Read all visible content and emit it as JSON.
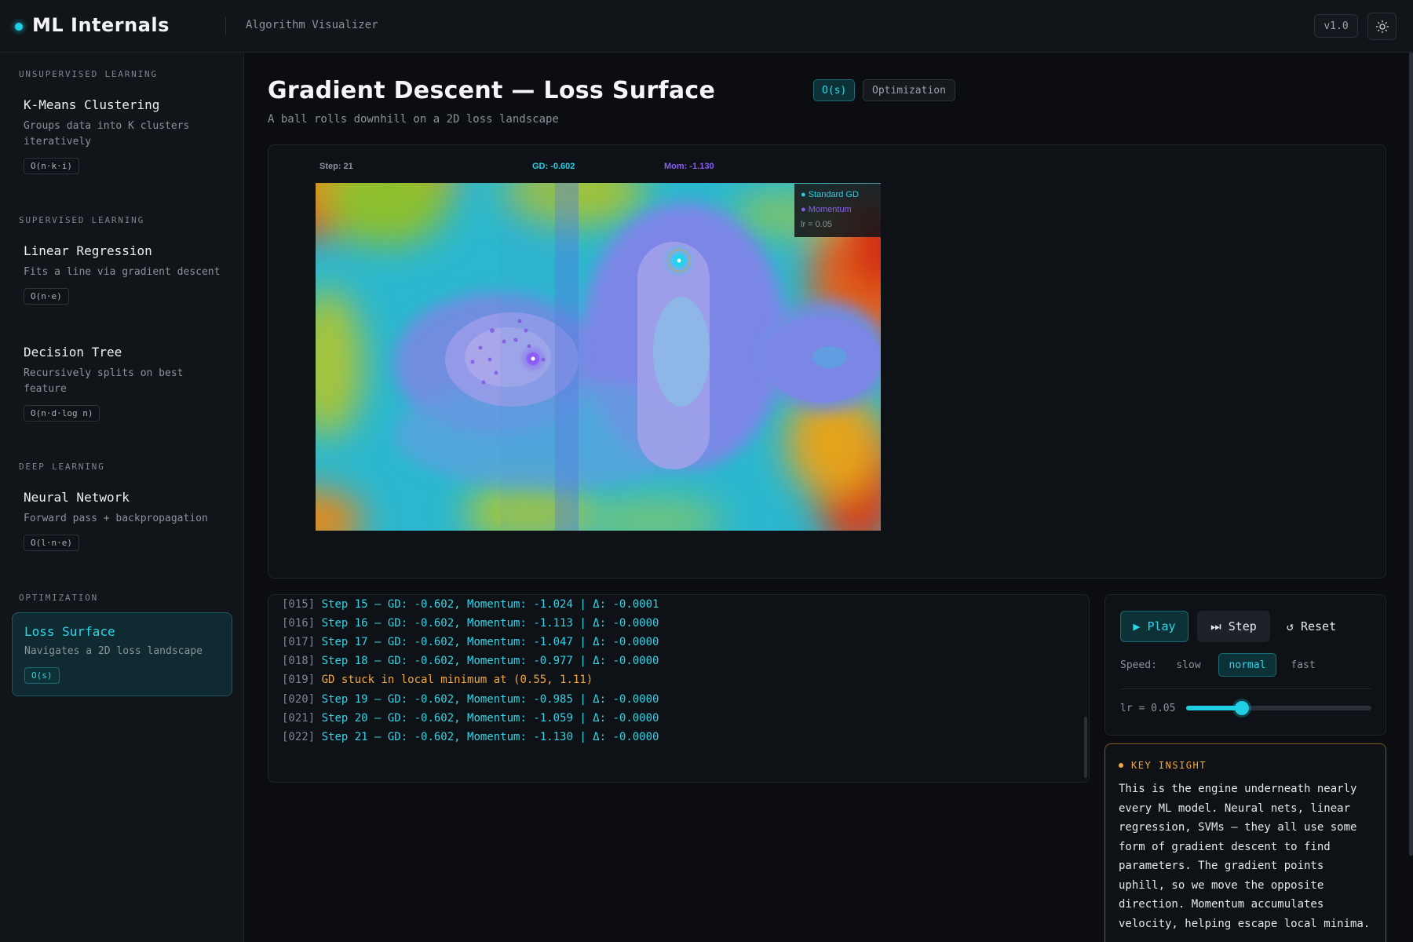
{
  "app": {
    "brand": "ML Internals",
    "subtitle": "Algorithm Visualizer",
    "version": "v1.0",
    "theme_icon": "sun-icon"
  },
  "sidebar": {
    "sections": [
      {
        "label": "UNSUPERVISED LEARNING",
        "items": [
          {
            "title": "K-Means Clustering",
            "desc": "Groups data into K clusters iteratively",
            "complexity": "O(n·k·i)"
          }
        ]
      },
      {
        "label": "SUPERVISED LEARNING",
        "items": [
          {
            "title": "Linear Regression",
            "desc": "Fits a line via gradient descent",
            "complexity": "O(n·e)"
          },
          {
            "title": "Decision Tree",
            "desc": "Recursively splits on best feature",
            "complexity": "O(n·d·log n)"
          }
        ]
      },
      {
        "label": "DEEP LEARNING",
        "items": [
          {
            "title": "Neural Network",
            "desc": "Forward pass + backpropagation",
            "complexity": "O(l·n·e)"
          }
        ]
      },
      {
        "label": "OPTIMIZATION",
        "items": [
          {
            "title": "Loss Surface",
            "desc": "Navigates a 2D loss landscape",
            "complexity": "O(s)",
            "active": true
          }
        ]
      }
    ]
  },
  "main": {
    "title": "Gradient Descent — Loss Surface",
    "complexity": "O(s)",
    "category": "Optimization",
    "description": "A ball rolls downhill on a 2D loss landscape"
  },
  "viz": {
    "step_text": "Step: 21",
    "gd_text": "GD: -0.602",
    "mom_text": "Mom: -1.130",
    "legend": {
      "standard": "Standard GD",
      "momentum": "Momentum",
      "lr": "lr = 0.05"
    },
    "colors": {
      "standard": "#22d3ee",
      "momentum": "#8b5cf6"
    }
  },
  "log": {
    "lines": [
      {
        "num": "[015]",
        "msg": "Step 15 — GD: -0.602, Momentum: -1.024 | Δ: -0.0001",
        "type": "info"
      },
      {
        "num": "[016]",
        "msg": "Step 16 — GD: -0.602, Momentum: -1.113 | Δ: -0.0000",
        "type": "info"
      },
      {
        "num": "[017]",
        "msg": "Step 17 — GD: -0.602, Momentum: -1.047 | Δ: -0.0000",
        "type": "info"
      },
      {
        "num": "[018]",
        "msg": "Step 18 — GD: -0.602, Momentum: -0.977 | Δ: -0.0000",
        "type": "info"
      },
      {
        "num": "[019]",
        "msg": "GD stuck in local minimum at (0.55, 1.11)",
        "type": "warn"
      },
      {
        "num": "[020]",
        "msg": "Step 19 — GD: -0.602, Momentum: -0.985 | Δ: -0.0000",
        "type": "info"
      },
      {
        "num": "[021]",
        "msg": "Step 20 — GD: -0.602, Momentum: -1.059 | Δ: -0.0000",
        "type": "info"
      },
      {
        "num": "[022]",
        "msg": "Step 21 — GD: -0.602, Momentum: -1.130 | Δ: -0.0000",
        "type": "info"
      }
    ]
  },
  "controls": {
    "play": "▶ Play",
    "step": "⏭ Step",
    "reset": "↺ Reset",
    "speed_label": "Speed:",
    "speeds": [
      "slow",
      "normal",
      "fast"
    ],
    "speed_selected": "normal",
    "lr_label": "lr = 0.05",
    "lr_fraction": 0.3
  },
  "insight": {
    "title": "KEY INSIGHT",
    "body": "This is the engine underneath nearly every ML model. Neural nets, linear regression, SVMs — they all use some form of gradient descent to find parameters. The gradient points uphill, so we move the opposite direction. Momentum accumulates velocity, helping escape local minima."
  }
}
